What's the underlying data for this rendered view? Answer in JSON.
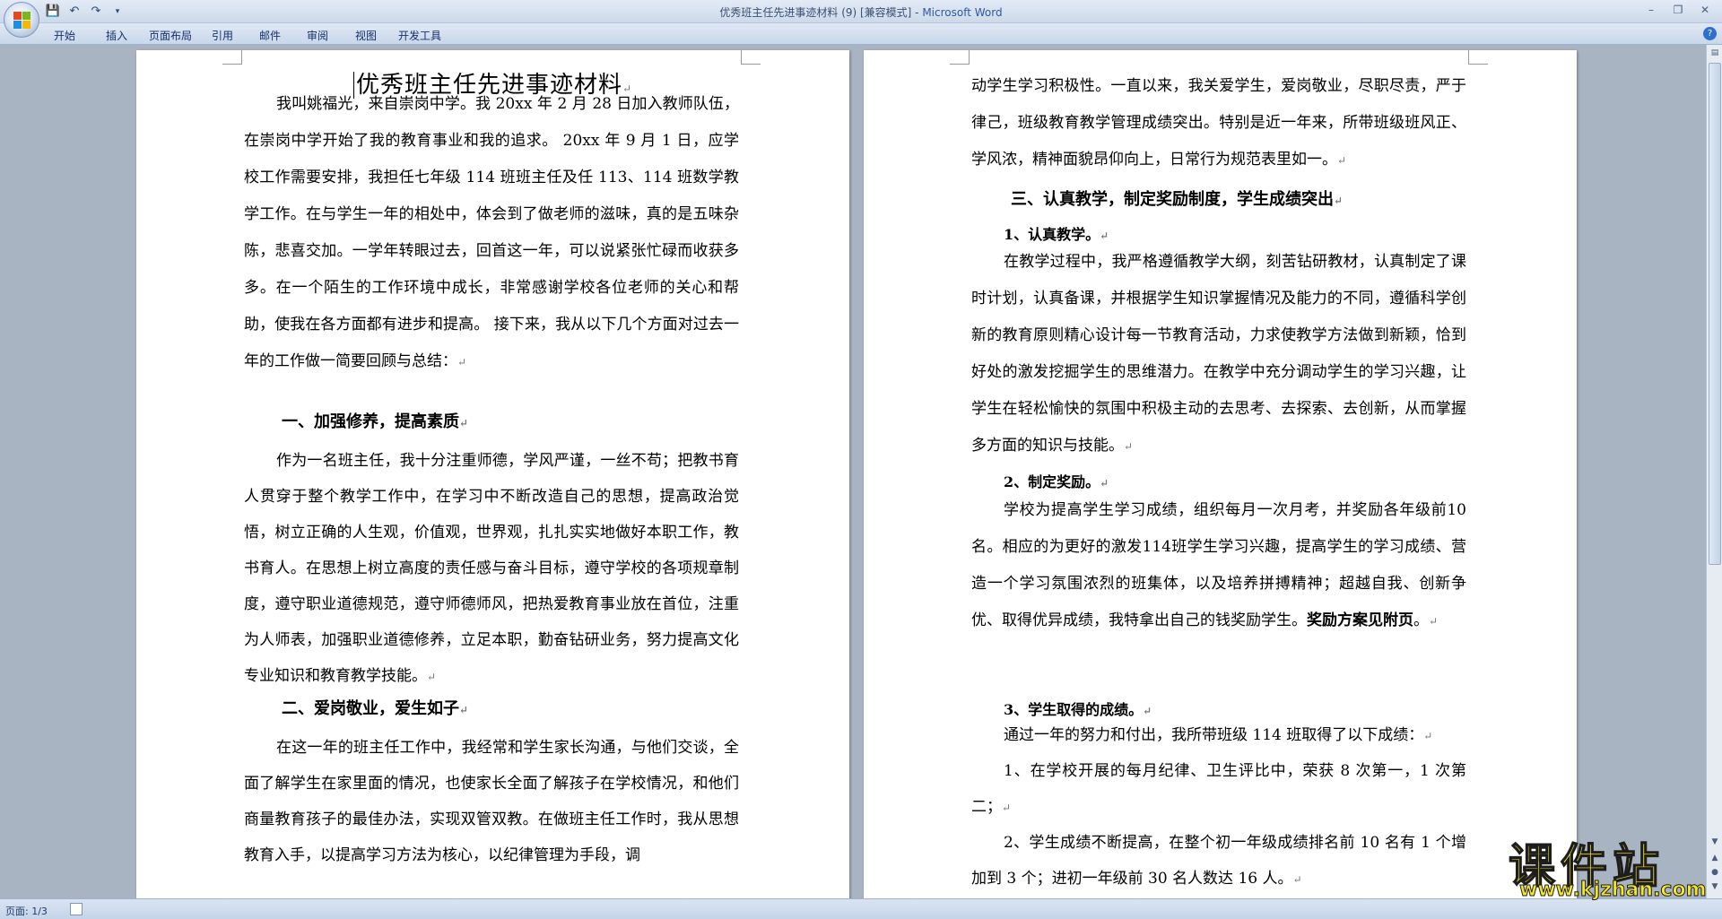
{
  "window": {
    "title_doc": "优秀班主任先进事迹材料 (9) [兼容模式] - ",
    "title_app": "Microsoft Word",
    "help": "?"
  },
  "ribbon": {
    "tabs": [
      "开始",
      "插入",
      "页面布局",
      "引用",
      "邮件",
      "审阅",
      "视图",
      "开发工具"
    ]
  },
  "document": {
    "title": "优秀班主任先进事迹材料",
    "page1": {
      "intro": "我叫姚福光，来自崇岗中学。我 20xx 年 2 月 28 日加入教师队伍，在崇岗中学开始了我的教育事业和我的追求。 20xx 年 9 月 1 日，应学校工作需要安排，我担任七年级 114 班班主任及任 113、114 班数学教学工作。在与学生一年的相处中，体会到了做老师的滋味，真的是五味杂陈，悲喜交加。一学年转眼过去，回首这一年，可以说紧张忙碌而收获多多。在一个陌生的工作环境中成长，非常感谢学校各位老师的关心和帮助，使我在各方面都有进步和提高。 接下来，我从以下几个方面对过去一年的工作做一简要回顾与总结：",
      "heading1": "一、加强修养，提高素质",
      "para1": "作为一名班主任，我十分注重师德，学风严谨，一丝不苟；把教书育人贯穿于整个教学工作中，在学习中不断改造自己的思想，提高政治觉悟，树立正确的人生观，价值观，世界观，扎扎实实地做好本职工作，教书育人。在思想上树立高度的责任感与奋斗目标，遵守学校的各项规章制度，遵守职业道德规范，遵守师德师风，把热爱教育事业放在首位，注重为人师表，加强职业道德修养，立足本职，勤奋钻研业务，努力提高文化专业知识和教育教学技能。",
      "heading2": "二、爱岗敬业，爱生如子",
      "para2": "在这一年的班主任工作中，我经常和学生家长沟通，与他们交谈，全面了解学生在家里面的情况，也使家长全面了解孩子在学校情况，和他们商量教育孩子的最佳办法，实现双管双教。在做班主任工作时，我从思想教育入手，以提高学习方法为核心，以纪律管理为手段，调"
    },
    "page2": {
      "cont": "动学生学习积极性。一直以来，我关爱学生，爱岗敬业，尽职尽责，严于律己，班级教育教学管理成绩突出。特别是近一年来，所带班级班风正、学风浓，精神面貌昂仰向上，日常行为规范表里如一。",
      "heading3": "三、认真教学，制定奖励制度，学生成绩突出",
      "sub1": "1、认真教学。",
      "para3": "在教学过程中，我严格遵循教学大纲，刻苦钻研教材，认真制定了课时计划，认真备课，并根据学生知识掌握情况及能力的不同，遵循科学创新的教育原则精心设计每一节教育活动，力求使教学方法做到新颖，恰到好处的激发挖掘学生的思维潜力。在教学中充分调动学生的学习兴趣，让学生在轻松愉快的氛围中积极主动的去思考、去探索、去创新，从而掌握多方面的知识与技能。",
      "sub2": "2、制定奖励。",
      "para4a": "学校为提高学生学习成绩，组织每月一次月考，并奖励各年级前10名。相应的为更好的激发114班学生学习兴趣，提高学生的学习成绩、营造一个学习氛围浓烈的班集体，以及培养拼搏精神；超越自我、创新争优、取得优异成绩，我特拿出自己的钱奖励学生。",
      "para4b": "奖励方案见附页",
      "para4c": "。",
      "sub3": "3、学生取得的成绩。",
      "para5": "通过一年的努力和付出，我所带班级 114 班取得了以下成绩：",
      "item1": "1、在学校开展的每月纪律、卫生评比中，荣获 8 次第一，1 次第二；",
      "item2": "2、学生成绩不断提高，在整个初一年级成绩排名前 10 名有 1 个增加到 3 个；进初一年级前 30 名人数达 16 人。"
    }
  },
  "status": {
    "page": "页面: 1/3"
  },
  "watermark": {
    "title": "课件站",
    "url": "www.kjzhan.com"
  }
}
